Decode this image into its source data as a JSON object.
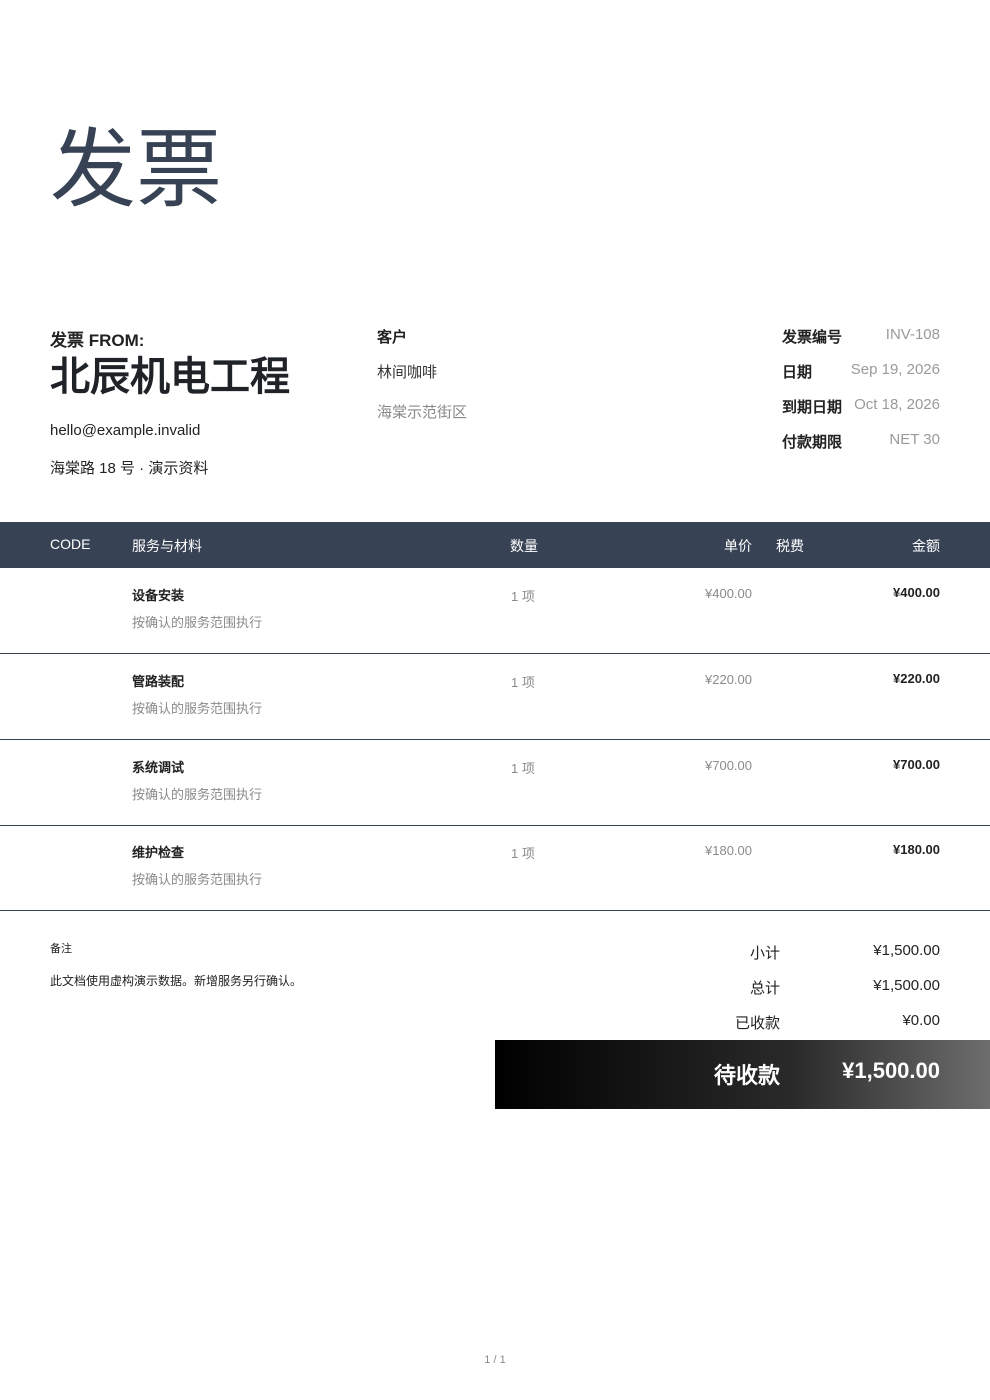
{
  "title": "发票",
  "from": {
    "label": "发票 FROM:",
    "company": "北辰机电工程",
    "email": "hello@example.invalid",
    "address": "海棠路 18 号 · 演示资料"
  },
  "client": {
    "label": "客户",
    "name": "林间咖啡",
    "address": "海棠示范街区"
  },
  "meta": [
    {
      "key": "发票编号",
      "value": "INV-108"
    },
    {
      "key": "日期",
      "value": "Sep 19, 2026"
    },
    {
      "key": "到期日期",
      "value": "Oct 18, 2026"
    },
    {
      "key": "付款期限",
      "value": "NET 30"
    }
  ],
  "table": {
    "headers": {
      "code": "CODE",
      "item": "服务与材料",
      "qty": "数量",
      "price": "单价",
      "tax": "税费",
      "amount": "金额"
    },
    "rows": [
      {
        "name": "设备安装",
        "desc": "按确认的服务范围执行",
        "qty": "1 项",
        "price": "¥400.00",
        "amount": "¥400.00"
      },
      {
        "name": "管路装配",
        "desc": "按确认的服务范围执行",
        "qty": "1 项",
        "price": "¥220.00",
        "amount": "¥220.00"
      },
      {
        "name": "系统调试",
        "desc": "按确认的服务范围执行",
        "qty": "1 项",
        "price": "¥700.00",
        "amount": "¥700.00"
      },
      {
        "name": "维护检查",
        "desc": "按确认的服务范围执行",
        "qty": "1 项",
        "price": "¥180.00",
        "amount": "¥180.00"
      }
    ]
  },
  "notes": {
    "label": "备注",
    "text": "此文档使用虚构演示数据。新增服务另行确认。"
  },
  "totals": {
    "subtotal_label": "小计",
    "subtotal": "¥1,500.00",
    "total_label": "总计",
    "total": "¥1,500.00",
    "paid_label": "已收款",
    "paid": "¥0.00",
    "due_label": "待收款",
    "due": "¥1,500.00"
  },
  "pager": "1 / 1",
  "colors": {
    "header_bg": "#374355",
    "title": "#374355"
  }
}
